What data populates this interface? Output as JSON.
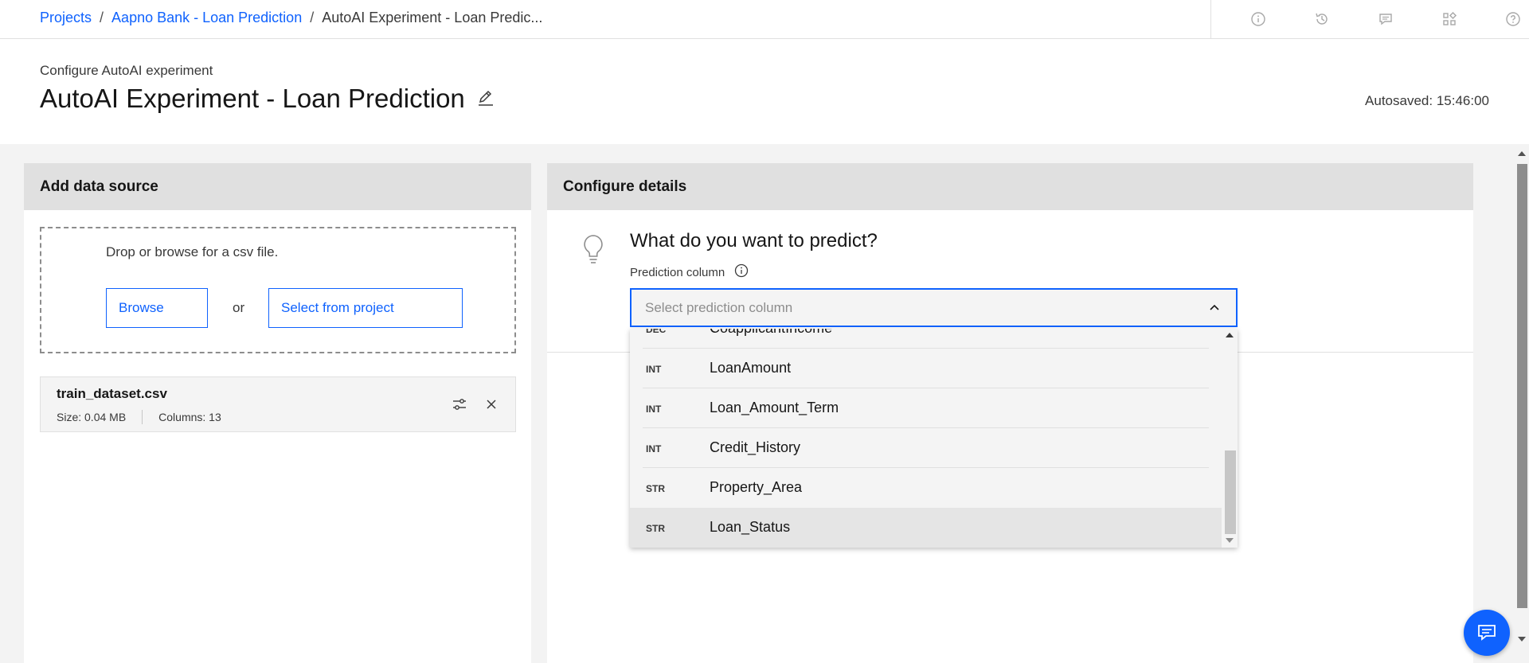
{
  "breadcrumb": {
    "projects": "Projects",
    "project": "Aapno Bank - Loan Prediction",
    "current": "AutoAI Experiment - Loan Predic...",
    "sep1": "/",
    "sep2": "/"
  },
  "header_icons": [
    "info-icon",
    "history-icon",
    "comment-icon",
    "apps-icon",
    "help-icon"
  ],
  "page": {
    "subtitle": "Configure AutoAI experiment",
    "title": "AutoAI Experiment - Loan Prediction",
    "autosaved": "Autosaved: 15:46:00"
  },
  "data_source": {
    "heading": "Add data source",
    "drop_hint": "Drop or browse for a csv file.",
    "browse_label": "Browse",
    "or": "or",
    "select_project_label": "Select from project",
    "file": {
      "name": "train_dataset.csv",
      "size": "Size: 0.04 MB",
      "columns": "Columns: 13"
    }
  },
  "details": {
    "heading": "Configure details",
    "question": "What do you want to predict?",
    "prediction_label": "Prediction column",
    "select_placeholder": "Select prediction column"
  },
  "dropdown": {
    "items": [
      {
        "type": "DEC",
        "name": "CoapplicantIncome"
      },
      {
        "type": "INT",
        "name": "LoanAmount"
      },
      {
        "type": "INT",
        "name": "Loan_Amount_Term"
      },
      {
        "type": "INT",
        "name": "Credit_History"
      },
      {
        "type": "STR",
        "name": "Property_Area"
      },
      {
        "type": "STR",
        "name": "Loan_Status"
      }
    ],
    "highlighted_index": 5
  },
  "colors": {
    "accent": "#0f62fe",
    "panel_header": "#e0e0e0",
    "background": "#f3f3f3"
  }
}
